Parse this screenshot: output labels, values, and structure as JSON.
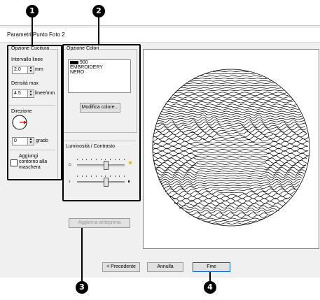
{
  "callouts": [
    "1",
    "2",
    "3",
    "4"
  ],
  "window": {
    "title": "Parametri Punto Foto 2"
  },
  "cucitura": {
    "group_label": "Opzione Cucitura",
    "interval_label": "Intervallo linee",
    "interval_value": "2.0",
    "interval_unit": "mm",
    "density_label": "Densità max",
    "density_value": "4.5",
    "density_unit": "linee/mm",
    "direction_label": "Direzione",
    "angle_value": "0",
    "angle_unit": "grado",
    "mask_label": "Aggiungi contorno alla maschera",
    "mask_checked": false
  },
  "colori": {
    "group_label": "Opzione Colori",
    "items": [
      {
        "code": "900",
        "swatch": "#000000"
      },
      {
        "code": "EMBROIDERY"
      },
      {
        "code": "NERO"
      }
    ],
    "modify_button": "Modifica colore...",
    "lum_group_label": "Luminosità / Contrasto",
    "brightness_level": 0.62,
    "contrast_level": 0.62
  },
  "buttons": {
    "update_preview": "Aggiorna anteprima",
    "back": "< Precedente",
    "cancel": "Annulla",
    "finish": "Fine"
  },
  "icons": {
    "sun_small": "☼",
    "sun_large": "☀",
    "contrast_low": "◑",
    "contrast_high": "◐",
    "spin_up": "▲",
    "spin_down": "▼"
  }
}
